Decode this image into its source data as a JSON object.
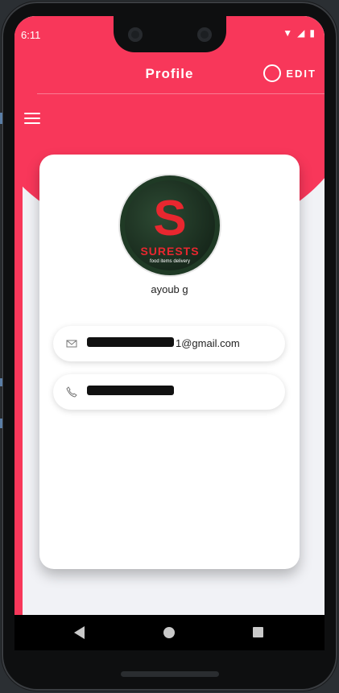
{
  "status": {
    "time": "6:11"
  },
  "header": {
    "title": "Profile",
    "edit_label": "EDIT"
  },
  "profile": {
    "name": "ayoub g",
    "email_visible_suffix": "1@gmail.com",
    "logo_letter": "S",
    "logo_name": "SURESTS",
    "logo_tagline": "food items delivery"
  },
  "colors": {
    "accent": "#f8375a",
    "card": "#ffffff",
    "background": "#eef0f5"
  }
}
